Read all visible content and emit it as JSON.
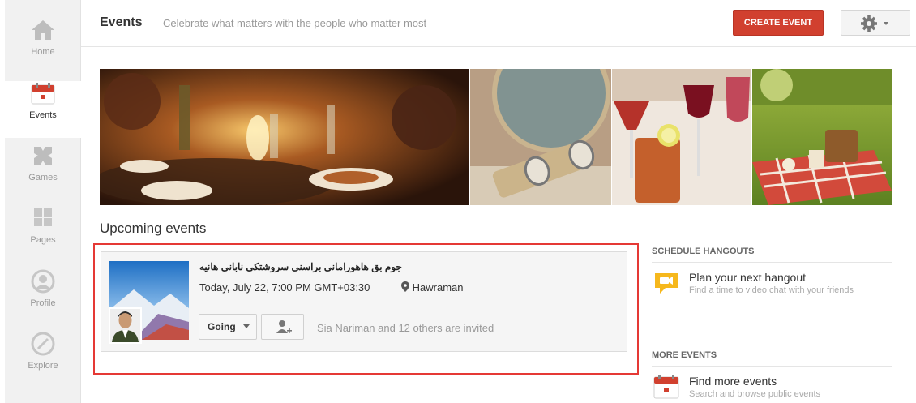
{
  "nav": {
    "items": [
      {
        "label": "Home"
      },
      {
        "label": "Events"
      },
      {
        "label": "Games"
      },
      {
        "label": "Pages"
      },
      {
        "label": "Profile"
      },
      {
        "label": "Explore"
      }
    ],
    "active": "Events"
  },
  "header": {
    "title": "Events",
    "tagline": "Celebrate what matters with the people who matter most",
    "create_label": "CREATE EVENT",
    "settings_icon": "gear-icon"
  },
  "upcoming": {
    "heading": "Upcoming events",
    "event": {
      "title": "جوم بق هاهورامانی براسنی سروشتکی نابانی هانیه",
      "when": "Today, July 22, 7:00 PM GMT+03:30",
      "place": "Hawraman",
      "rsvp_label": "Going",
      "invited_text": "Sia Nariman and 12 others are invited"
    }
  },
  "sidebar": {
    "hangouts": {
      "heading": "SCHEDULE HANGOUTS",
      "link": "Plan your next hangout",
      "sub": "Find a time to video chat with your friends"
    },
    "more": {
      "heading": "MORE EVENTS",
      "link": "Find more events",
      "sub": "Search and browse public events"
    }
  },
  "colors": {
    "accent": "#d1402f",
    "highlight": "#e53935",
    "hangout_icon": "#f6b81d"
  }
}
